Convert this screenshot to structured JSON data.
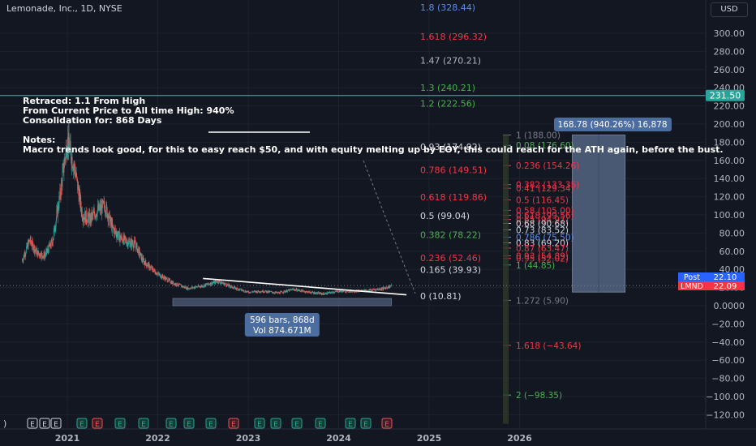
{
  "header": {
    "title": "Lemonade, Inc., 1D, NYSE"
  },
  "axis": {
    "currency_button": "USD"
  },
  "notes": {
    "line1": "Retraced: 1.1 From High",
    "line2": "From Current Price to All time High: 940%",
    "line3": "Consolidation for: 868 Days",
    "line4": "",
    "line5": "Notes:",
    "line6": "Macro trends look good, for this to easy reach $50, and with equity melting up by EOY, this could reach for the ATH again, before the bust."
  },
  "colors": {
    "background": "#131722",
    "grid": "#1e222d",
    "price_line": "#26a69a",
    "fib_red": "#f23645",
    "fib_green": "#4caf50",
    "fib_gray": "#b2b5be",
    "fib_blue": "#5d8ce3",
    "measure_box": "#5b6f8f",
    "up_candle": "#26a69a",
    "down_candle": "#ef5350",
    "label_post": "#2962ff",
    "label_lmnd": "#f23645"
  },
  "chart_data": {
    "type": "candlestick",
    "symbol": "LMND",
    "timeframe": "1D",
    "x_ticks": [
      "2021",
      "2022",
      "2023",
      "2024",
      "2025",
      "2026"
    ],
    "y_ticks": [
      300,
      280,
      260,
      240,
      220,
      200,
      180,
      160,
      140,
      120,
      100,
      80,
      60,
      40,
      20,
      0,
      -20,
      -40,
      -60,
      -80,
      -100,
      -120
    ],
    "y_tick_labels": [
      "300.00",
      "280.00",
      "260.00",
      "240.00",
      "220.00",
      "200.00",
      "180.00",
      "160.00",
      "140.00",
      "120.00",
      "100.00",
      "80.00",
      "60.00",
      "40.00",
      "20.00",
      "0.0000",
      "−20.00",
      "−40.00",
      "−60.00",
      "−80.00",
      "−100.00",
      "−120.00"
    ],
    "ylim": [
      -130,
      325
    ],
    "price_path": [
      [
        "2020-07",
        50
      ],
      [
        "2020-08",
        72
      ],
      [
        "2020-09",
        58
      ],
      [
        "2020-10",
        55
      ],
      [
        "2020-11",
        70
      ],
      [
        "2020-12",
        120
      ],
      [
        "2021-01",
        183
      ],
      [
        "2021-02",
        150
      ],
      [
        "2021-03",
        100
      ],
      [
        "2021-04",
        95
      ],
      [
        "2021-05",
        105
      ],
      [
        "2021-06",
        110
      ],
      [
        "2021-07",
        85
      ],
      [
        "2021-08",
        75
      ],
      [
        "2021-09",
        70
      ],
      [
        "2021-10",
        68
      ],
      [
        "2021-11",
        50
      ],
      [
        "2021-12",
        42
      ],
      [
        "2022-01",
        35
      ],
      [
        "2022-03",
        25
      ],
      [
        "2022-05",
        19
      ],
      [
        "2022-07",
        22
      ],
      [
        "2022-09",
        27
      ],
      [
        "2022-11",
        20
      ],
      [
        "2023-01",
        15
      ],
      [
        "2023-03",
        16
      ],
      [
        "2023-05",
        14
      ],
      [
        "2023-07",
        18
      ],
      [
        "2023-09",
        15
      ],
      [
        "2023-11",
        13
      ],
      [
        "2024-01",
        16
      ],
      [
        "2024-03",
        16
      ],
      [
        "2024-05",
        17
      ],
      [
        "2024-07",
        19
      ],
      [
        "2024-08",
        22
      ]
    ],
    "horizontal_line": {
      "value": 231.5,
      "label": "231.50"
    },
    "price_labels": [
      {
        "name": "Post",
        "value": "22.10"
      },
      {
        "name": "LMND",
        "value": "22.09"
      }
    ],
    "fib_levels": [
      {
        "label": "1.8 (328.44)",
        "value": 328.44,
        "color": "#5d8ce3"
      },
      {
        "label": "1.618 (296.32)",
        "value": 296.32,
        "color": "#f23645"
      },
      {
        "label": "1.47 (270.21)",
        "value": 270.21,
        "color": "#b2b5be"
      },
      {
        "label": "1.3 (240.21)",
        "value": 240.21,
        "color": "#4caf50"
      },
      {
        "label": "1.2 (222.56)",
        "value": 222.56,
        "color": "#4caf50"
      },
      {
        "label": "0.93 (174.92)",
        "value": 174.92,
        "color": "#d1d4dc"
      },
      {
        "label": "0.786 (149.51)",
        "value": 149.51,
        "color": "#f23645"
      },
      {
        "label": "0.618 (119.86)",
        "value": 119.86,
        "color": "#f23645"
      },
      {
        "label": "0.5 (99.04)",
        "value": 99.04,
        "color": "#d1d4dc"
      },
      {
        "label": "0.382 (78.22)",
        "value": 78.22,
        "color": "#4caf50"
      },
      {
        "label": "0.236 (52.46)",
        "value": 52.46,
        "color": "#f23645"
      },
      {
        "label": "0.165 (39.93)",
        "value": 39.93,
        "color": "#d1d4dc"
      },
      {
        "label": "0 (10.81)",
        "value": 10.81,
        "color": "#d1d4dc"
      }
    ],
    "fib_levels_2": [
      {
        "label": "1 (188.00)",
        "value": 188.0,
        "color": "#787b86"
      },
      {
        "label": "0.08 (176.60)",
        "value": 176.6,
        "color": "#4caf50"
      },
      {
        "label": "0.236 (154.26)",
        "value": 154.26,
        "color": "#f23645"
      },
      {
        "label": "0.382 (133.35)",
        "value": 133.35,
        "color": "#f23645"
      },
      {
        "label": "0.41 (129.34)",
        "value": 129.34,
        "color": "#f23645"
      },
      {
        "label": "0.5 (116.45)",
        "value": 116.45,
        "color": "#f23645"
      },
      {
        "label": "0.58 (105.00)",
        "value": 105.0,
        "color": "#f23645"
      },
      {
        "label": "0.618 (99.56)",
        "value": 99.56,
        "color": "#f23645"
      },
      {
        "label": "0.65 (94.97)",
        "value": 94.97,
        "color": "#f23645"
      },
      {
        "label": "0.68 (90.68)",
        "value": 90.68,
        "color": "#d1d4dc"
      },
      {
        "label": "0.73 (83.52)",
        "value": 83.52,
        "color": "#d1d4dc"
      },
      {
        "label": "0.786 (75.50)",
        "value": 75.5,
        "color": "#5d8ce3"
      },
      {
        "label": "0.83 (69.20)",
        "value": 69.2,
        "color": "#d1d4dc"
      },
      {
        "label": "0.87 (63.47)",
        "value": 63.47,
        "color": "#f23645"
      },
      {
        "label": "0.93 (54.89)",
        "value": 54.89,
        "color": "#f23645"
      },
      {
        "label": "0.95 (52.02)",
        "value": 52.02,
        "color": "#f23645"
      },
      {
        "label": "1 (44.85)",
        "value": 44.85,
        "color": "#4caf50"
      },
      {
        "label": "1.272 (5.90)",
        "value": 5.9,
        "color": "#787b86"
      },
      {
        "label": "1.618 (−43.64)",
        "value": -43.64,
        "color": "#f23645"
      },
      {
        "label": "2 (−98.35)",
        "value": -98.35,
        "color": "#4caf50"
      }
    ],
    "range_box": {
      "from": "2022-03",
      "to": "2024-08",
      "low": 0,
      "high": 8,
      "label_line1": "596 bars, 868d",
      "label_line2": "Vol 874.671M"
    },
    "target_box": {
      "from": "2026-08",
      "to": "2027-03",
      "low": 15,
      "high": 188,
      "label": "168.78 (940.26%) 16,878"
    },
    "trendline": {
      "from": [
        "2022-07",
        30
      ],
      "to": [
        "2024-10",
        12
      ]
    },
    "event_markers": [
      "E",
      "E",
      "E",
      "E",
      "E",
      "E",
      "E",
      "E",
      "E",
      "E",
      "E",
      "E",
      "E",
      "E",
      "E",
      "E",
      "E",
      "E",
      "E"
    ]
  }
}
